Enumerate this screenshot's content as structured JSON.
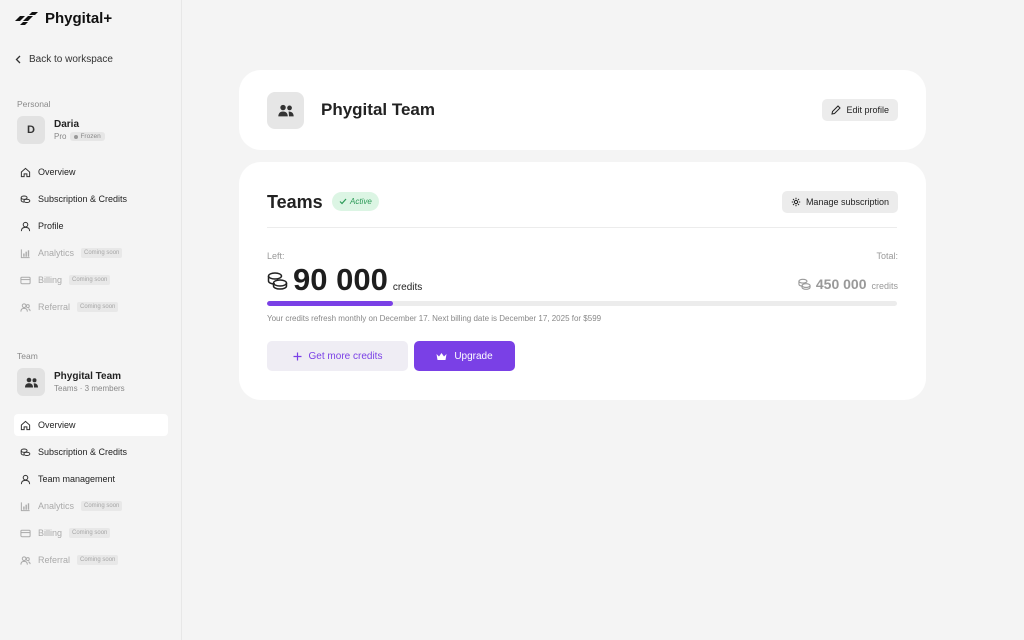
{
  "app": {
    "name": "Phygital+"
  },
  "sidebar": {
    "back_label": "Back to workspace",
    "personal": {
      "section_label": "Personal",
      "avatar_initial": "D",
      "name": "Daria",
      "plan": "Pro",
      "status_badge": "Frozen",
      "items": [
        {
          "label": "Overview",
          "icon": "home-icon",
          "coming_soon": false
        },
        {
          "label": "Subscription & Credits",
          "icon": "coins-icon",
          "coming_soon": false
        },
        {
          "label": "Profile",
          "icon": "user-icon",
          "coming_soon": false
        },
        {
          "label": "Analytics",
          "icon": "chart-icon",
          "coming_soon": true,
          "badge": "Coming soon"
        },
        {
          "label": "Billing",
          "icon": "card-icon",
          "coming_soon": true,
          "badge": "Coming soon"
        },
        {
          "label": "Referral",
          "icon": "users-icon",
          "coming_soon": true,
          "badge": "Coming soon"
        }
      ]
    },
    "team": {
      "section_label": "Team",
      "name": "Phygital Team",
      "subtitle": "Teams · 3 members",
      "items": [
        {
          "label": "Overview",
          "icon": "home-icon",
          "active": true
        },
        {
          "label": "Subscription & Credits",
          "icon": "coins-icon"
        },
        {
          "label": "Team management",
          "icon": "user-icon"
        },
        {
          "label": "Analytics",
          "icon": "chart-icon",
          "badge": "Coming soon"
        },
        {
          "label": "Billing",
          "icon": "card-icon",
          "badge": "Coming soon"
        },
        {
          "label": "Referral",
          "icon": "users-icon",
          "badge": "Coming soon"
        }
      ]
    }
  },
  "header_card": {
    "title": "Phygital Team",
    "edit_label": "Edit profile"
  },
  "plan_card": {
    "plan_name": "Teams",
    "status": "Active",
    "manage_label": "Manage subscription",
    "left_label": "Left:",
    "total_label": "Total:",
    "credits_left": "90 000",
    "credits_total": "450 000",
    "credits_unit": "credits",
    "progress_fraction": 0.2,
    "refresh_note": "Your credits refresh monthly on December 17. Next billing date is December 17, 2025 for $599",
    "get_more_label": "Get more credits",
    "upgrade_label": "Upgrade"
  },
  "colors": {
    "accent": "#7a40e6",
    "active_bg": "#dcf5e4",
    "active_text": "#2b9a57"
  }
}
